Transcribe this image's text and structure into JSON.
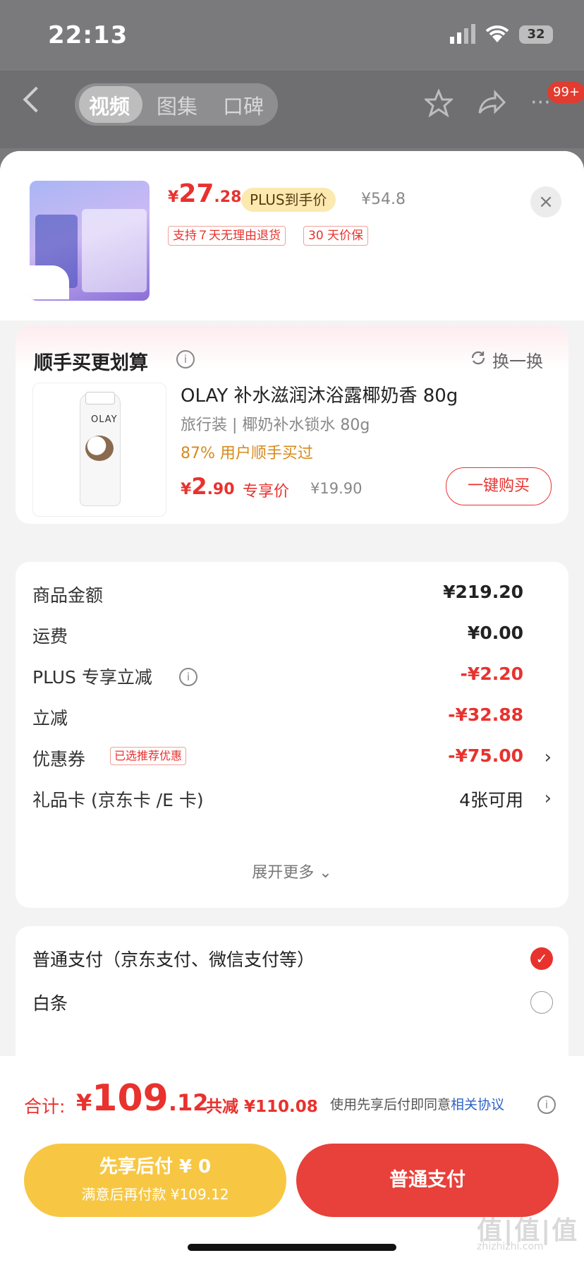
{
  "status_bar": {
    "time": "22:13",
    "battery": "32"
  },
  "top_nav": {
    "tabs": [
      "视频",
      "图集",
      "口碑"
    ],
    "active_tab": "视频",
    "cart_badge": "99+"
  },
  "product": {
    "price_symbol": "¥",
    "price_int": "27",
    "price_dec": ".28",
    "plus_badge": "PLUS到手价",
    "original_price": "¥54.8",
    "tags": [
      "支持７天无理由退货",
      "30 天价保"
    ],
    "close_icon": "×"
  },
  "recommend": {
    "title": "顺手买更划算",
    "swap_label": "换一换",
    "item": {
      "brand": "OLAY",
      "title": "OLAY 补水滋润沐浴露椰奶香 80g",
      "subtitle": "旅行装 | 椰奶补水锁水 80g",
      "stat": "87% 用户顺手买过",
      "price_symbol": "¥",
      "price_int": "2",
      "price_dec": ".90",
      "price_label": "专享价",
      "original_price": "¥19.90",
      "buy_button": "一键购买"
    }
  },
  "fees": {
    "rows": [
      {
        "label": "商品金额",
        "value": "¥219.20"
      },
      {
        "label": "运费",
        "value": "¥0.00"
      },
      {
        "label": "PLUS 专享立减",
        "value": "-¥2.20"
      },
      {
        "label": "立减",
        "value": "-¥32.88"
      },
      {
        "label": "优惠券",
        "tag": "已选推荐优惠",
        "value": "-¥75.00"
      },
      {
        "label": "礼品卡 (京东卡 /E 卡)",
        "value": "4张可用"
      }
    ],
    "expand": "展开更多 ⌄"
  },
  "payment": {
    "options": [
      "普通支付（京东支付、微信支付等）",
      "白条"
    ],
    "selected": 0
  },
  "footer": {
    "total_label": "合计:",
    "total_symbol": "¥",
    "total_int": "109",
    "total_dec": ".12",
    "reduction": "共减 ¥110.08",
    "agree_text": "使用先享后付即同意",
    "agree_link": "相关协议",
    "later_line1": "先享后付 ¥ 0",
    "later_line2": "满意后再付款 ¥109.12",
    "pay_button": "普通支付"
  },
  "watermark": {
    "main": "值|值|值",
    "sub": "zhizhizhi.com"
  },
  "colors": {
    "accent_red": "#e8322e",
    "gold": "#f7c744",
    "link_blue": "#2c62c8"
  }
}
